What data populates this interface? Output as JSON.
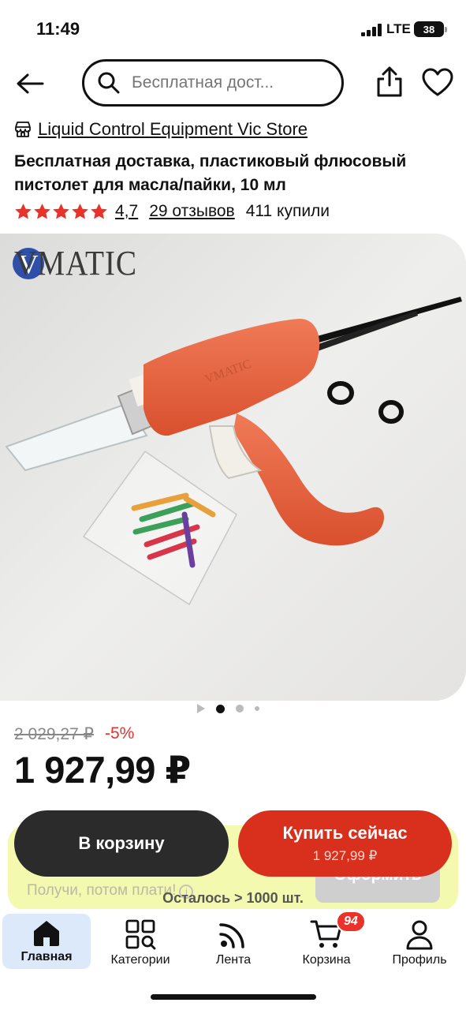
{
  "status": {
    "time": "11:49",
    "network": "LTE",
    "battery": "38"
  },
  "search": {
    "placeholder": "Бесплатная дост..."
  },
  "store": {
    "name": "Liquid Control Equipment Vic Store"
  },
  "product": {
    "title": "Бесплатная доставка, пластиковый флюсовый пистолет для масла/пайки, 10 мл",
    "rating": "4,7",
    "rating_stars": 5,
    "reviews": "29 отзывов",
    "bought": "411 купили",
    "image_logo": "VMATIC",
    "image_count": 4,
    "image_current": 2,
    "old_price": "2 029,27 ₽",
    "discount": "-5%",
    "price": "1 927,99 ₽"
  },
  "promo": {
    "text": "Получи, потом плати!",
    "info_icon": "i",
    "button": "Оформить"
  },
  "actions": {
    "cart_label": "В корзину",
    "buy_label": "Купить сейчас",
    "buy_price": "1 927,99 ₽"
  },
  "stock": "Осталось > 1000 шт.",
  "tabbar": {
    "items": [
      {
        "label": "Главная",
        "icon": "home-icon"
      },
      {
        "label": "Категории",
        "icon": "categories-icon"
      },
      {
        "label": "Лента",
        "icon": "feed-icon"
      },
      {
        "label": "Корзина",
        "icon": "cart-icon",
        "badge": "94"
      },
      {
        "label": "Профиль",
        "icon": "profile-icon"
      }
    ]
  },
  "colors": {
    "accent": "#d9301d",
    "dark_button": "#2b2b2b",
    "promo_bg": "#f4f9b0",
    "active_tab": "#dbe9fb"
  }
}
